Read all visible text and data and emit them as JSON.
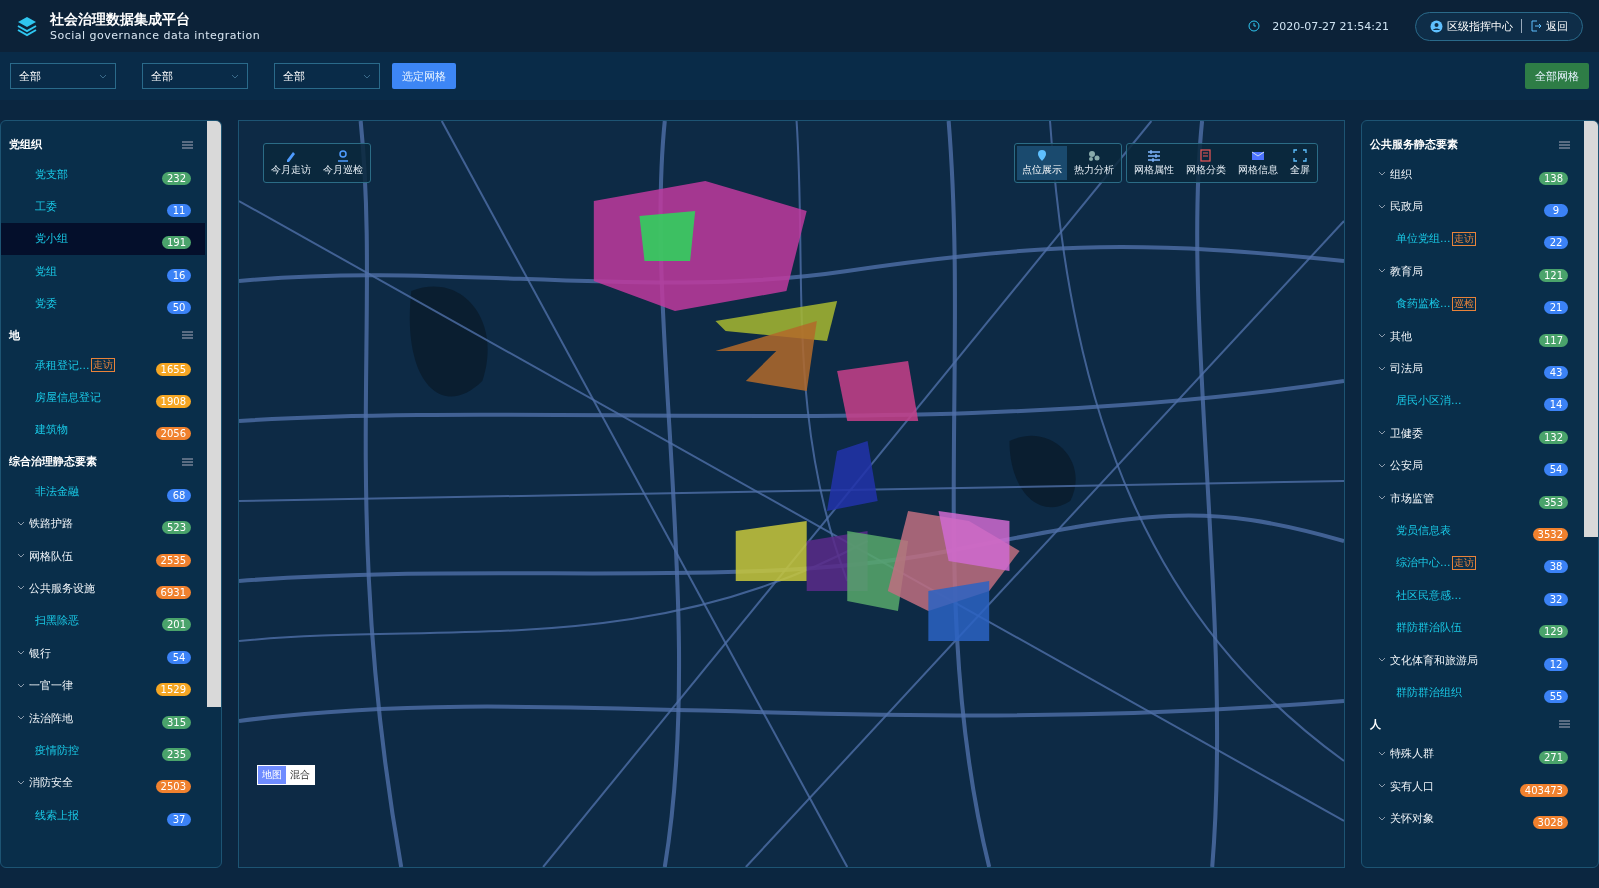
{
  "header": {
    "title": "社会治理数据集成平台",
    "subtitle": "Social governance data integration",
    "datetime": "2020-07-27 21:54:21",
    "user": "区级指挥中心",
    "back": "返回"
  },
  "filters": {
    "selects": [
      "全部",
      "全部",
      "全部"
    ],
    "apply": "选定网格",
    "all_grids": "全部网格"
  },
  "left_panel": {
    "sections": [
      {
        "title": "党组织",
        "items": [
          {
            "label": "党支部",
            "kind": "leaf",
            "count": "232",
            "color": "#4aa36b",
            "selected": false
          },
          {
            "label": "工委",
            "kind": "leaf",
            "count": "11",
            "color": "#3b82f6",
            "selected": false
          },
          {
            "label": "党小组",
            "kind": "leaf",
            "count": "191",
            "color": "#4aa36b",
            "selected": true
          },
          {
            "label": "党组",
            "kind": "leaf",
            "count": "16",
            "color": "#3b82f6",
            "selected": false
          },
          {
            "label": "党委",
            "kind": "leaf",
            "count": "50",
            "color": "#3b82f6",
            "selected": false
          }
        ]
      },
      {
        "title": "地",
        "items": [
          {
            "label": "承租登记...",
            "tag": "走访",
            "kind": "leaf",
            "count": "1655",
            "color": "#f5a623",
            "selected": false
          },
          {
            "label": "房屋信息登记",
            "kind": "leaf",
            "count": "1908",
            "color": "#f5a623",
            "selected": false
          },
          {
            "label": "建筑物",
            "kind": "leaf",
            "count": "2056",
            "color": "#f0812e",
            "selected": false
          }
        ]
      },
      {
        "title": "综合治理静态要素",
        "items": [
          {
            "label": "非法金融",
            "kind": "leaf",
            "count": "68",
            "color": "#3b82f6",
            "selected": false
          },
          {
            "label": "铁路护路",
            "kind": "group",
            "count": "523",
            "color": "#4aa36b",
            "selected": false
          },
          {
            "label": "网格队伍",
            "kind": "group",
            "count": "2535",
            "color": "#f0812e",
            "selected": false
          },
          {
            "label": "公共服务设施",
            "kind": "group",
            "count": "6931",
            "color": "#f0812e",
            "selected": false
          },
          {
            "label": "扫黑除恶",
            "kind": "leaf",
            "count": "201",
            "color": "#4aa36b",
            "selected": false
          },
          {
            "label": "银行",
            "kind": "group",
            "count": "54",
            "color": "#3b82f6",
            "selected": false
          },
          {
            "label": "一官一律",
            "kind": "group",
            "count": "1529",
            "color": "#f5a623",
            "selected": false
          },
          {
            "label": "法治阵地",
            "kind": "group",
            "count": "315",
            "color": "#4aa36b",
            "selected": false
          },
          {
            "label": "疫情防控",
            "kind": "leaf",
            "count": "235",
            "color": "#4aa36b",
            "selected": false
          },
          {
            "label": "消防安全",
            "kind": "group",
            "count": "2503",
            "color": "#f0812e",
            "selected": false
          },
          {
            "label": "线索上报",
            "kind": "leaf",
            "count": "37",
            "color": "#3b82f6",
            "selected": false
          }
        ]
      }
    ]
  },
  "map": {
    "left_tools": [
      {
        "label": "今月走访"
      },
      {
        "label": "今月巡检"
      }
    ],
    "view_tools": [
      {
        "label": "点位展示",
        "selected": true
      },
      {
        "label": "热力分析",
        "selected": false
      }
    ],
    "grid_tools": [
      {
        "label": "网格属性"
      },
      {
        "label": "网格分类"
      },
      {
        "label": "网格信息"
      },
      {
        "label": "全屏"
      }
    ],
    "layers": [
      {
        "label": "地图",
        "selected": true
      },
      {
        "label": "混合",
        "selected": false
      }
    ]
  },
  "right_panel": {
    "sections": [
      {
        "title": "公共服务静态要素",
        "items": [
          {
            "label": "组织",
            "kind": "group",
            "count": "138",
            "color": "#4aa36b",
            "selected": false
          },
          {
            "label": "民政局",
            "kind": "group",
            "count": "9",
            "color": "#3b82f6",
            "selected": false
          },
          {
            "label": "单位党组...",
            "tag": "走访",
            "kind": "leaf",
            "count": "22",
            "color": "#3b82f6",
            "selected": false
          },
          {
            "label": "教育局",
            "kind": "group",
            "count": "121",
            "color": "#4aa36b",
            "selected": false
          },
          {
            "label": "食药监检...",
            "tag": "巡检",
            "kind": "leaf",
            "count": "21",
            "color": "#3b82f6",
            "selected": false
          },
          {
            "label": "其他",
            "kind": "group",
            "count": "117",
            "color": "#4aa36b",
            "selected": false
          },
          {
            "label": "司法局",
            "kind": "group",
            "count": "43",
            "color": "#3b82f6",
            "selected": false
          },
          {
            "label": "居民小区消...",
            "kind": "leaf",
            "count": "14",
            "color": "#3b82f6",
            "selected": false
          },
          {
            "label": "卫健委",
            "kind": "group",
            "count": "132",
            "color": "#4aa36b",
            "selected": false
          },
          {
            "label": "公安局",
            "kind": "group",
            "count": "54",
            "color": "#3b82f6",
            "selected": false
          },
          {
            "label": "市场监管",
            "kind": "group",
            "count": "353",
            "color": "#4aa36b",
            "selected": false
          },
          {
            "label": "党员信息表",
            "kind": "leaf",
            "count": "3532",
            "color": "#f0812e",
            "selected": false
          },
          {
            "label": "综治中心...",
            "tag": "走访",
            "kind": "leaf",
            "count": "38",
            "color": "#3b82f6",
            "selected": false
          },
          {
            "label": "社区民意感...",
            "kind": "leaf",
            "count": "32",
            "color": "#3b82f6",
            "selected": false
          },
          {
            "label": "群防群治队伍",
            "kind": "leaf",
            "count": "129",
            "color": "#4aa36b",
            "selected": false
          },
          {
            "label": "文化体育和旅游局",
            "kind": "group",
            "count": "12",
            "color": "#3b82f6",
            "selected": false
          },
          {
            "label": "群防群治组织",
            "kind": "leaf",
            "count": "55",
            "color": "#3b82f6",
            "selected": false
          }
        ]
      },
      {
        "title": "人",
        "items": [
          {
            "label": "特殊人群",
            "kind": "group",
            "count": "271",
            "color": "#4aa36b",
            "selected": false
          },
          {
            "label": "实有人口",
            "kind": "group",
            "count": "403473",
            "color": "#f0812e",
            "selected": false
          },
          {
            "label": "关怀对象",
            "kind": "group",
            "count": "3028",
            "color": "#f0812e",
            "selected": false
          }
        ]
      }
    ]
  }
}
